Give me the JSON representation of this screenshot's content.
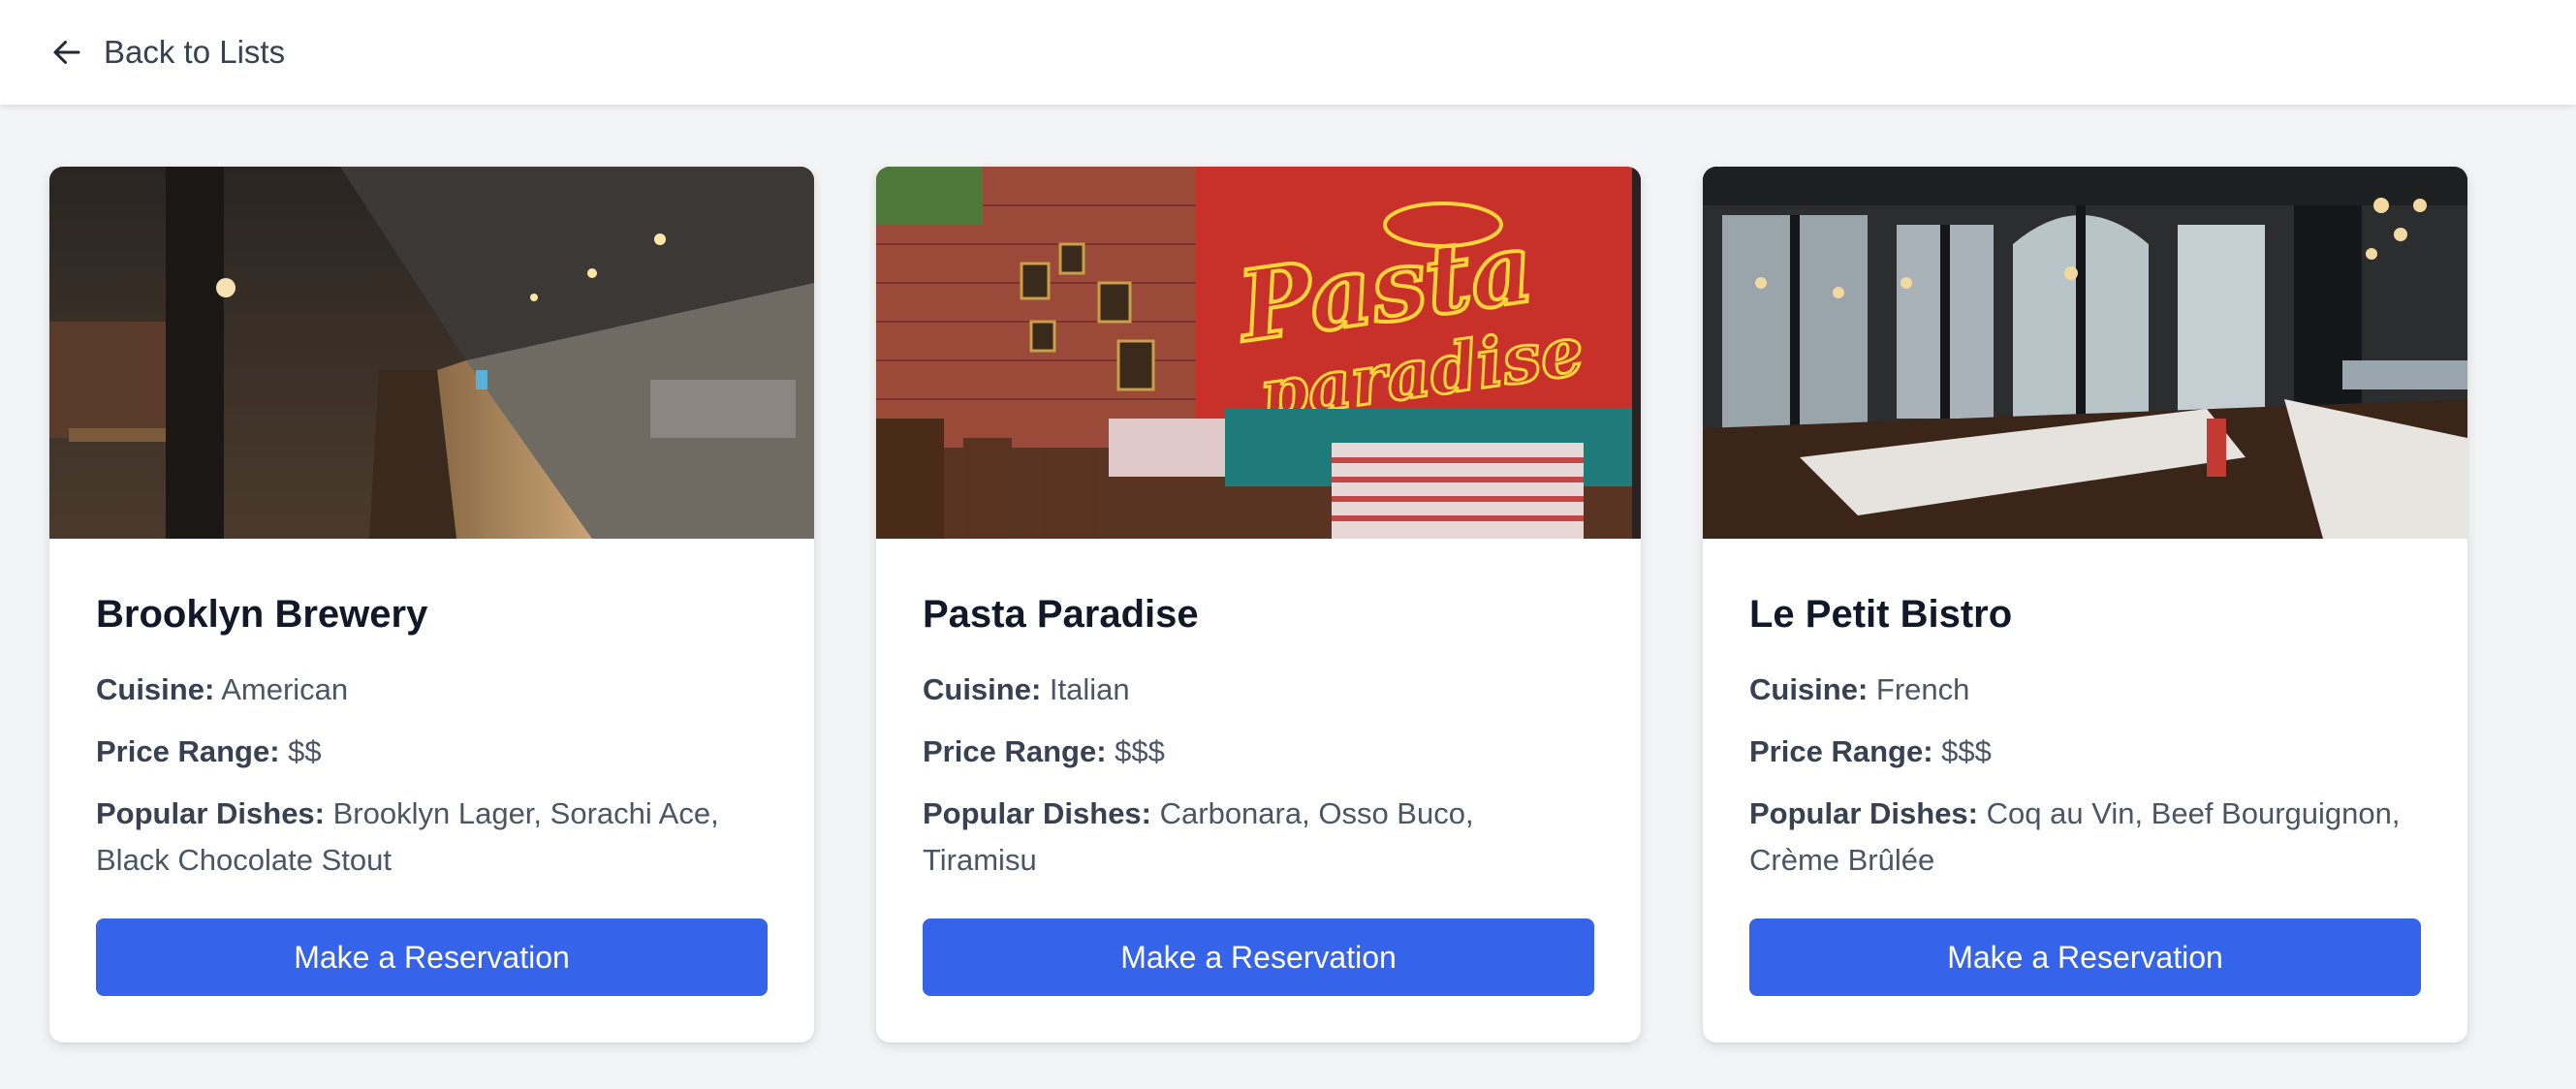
{
  "header": {
    "back_label": "Back to Lists"
  },
  "labels": {
    "cuisine": "Cuisine:",
    "price_range": "Price Range:",
    "popular_dishes": "Popular Dishes:"
  },
  "restaurants": [
    {
      "name": "Brooklyn Brewery",
      "cuisine": "American",
      "price_range": "$$",
      "popular_dishes": "Brooklyn Lager, Sorachi Ace, Black Chocolate Stout",
      "button_label": "Make a Reservation",
      "photo": "brewery-interior-photo"
    },
    {
      "name": "Pasta Paradise",
      "cuisine": "Italian",
      "price_range": "$$$",
      "popular_dishes": "Carbonara, Osso Buco, Tiramisu",
      "button_label": "Make a Reservation",
      "photo": "italian-restaurant-photo",
      "sign_text": [
        "Pasta",
        "paradise"
      ]
    },
    {
      "name": "Le Petit Bistro",
      "cuisine": "French",
      "price_range": "$$$",
      "popular_dishes": "Coq au Vin, Beef Bourguignon, Crème Brûlée",
      "button_label": "Make a Reservation",
      "photo": "bistro-interior-photo"
    }
  ],
  "colors": {
    "accent": "#3563e9",
    "background": "#f3f4f6"
  }
}
